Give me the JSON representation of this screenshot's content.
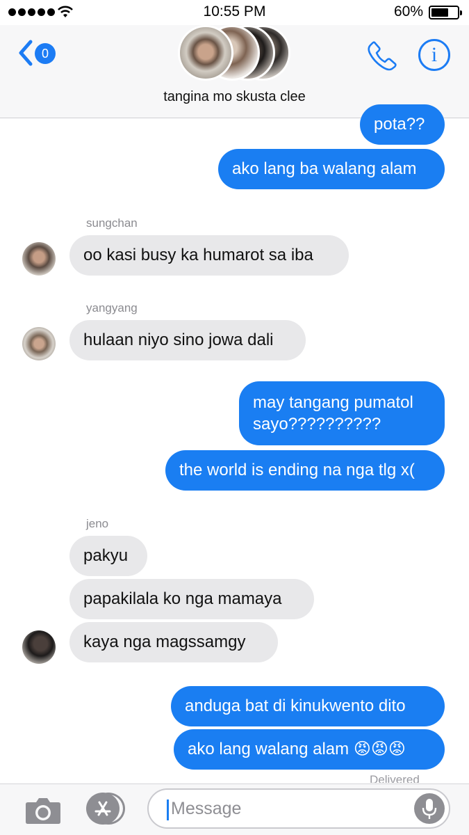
{
  "status_bar": {
    "time": "10:55 PM",
    "battery_percent": "60%",
    "battery_level": 0.6,
    "signal_dots": 5
  },
  "header": {
    "back_badge": "0",
    "group_name": "tangina mo skusta clee",
    "icons": [
      "chevron-left-icon",
      "phone-icon",
      "info-icon"
    ]
  },
  "messages": [
    {
      "direction": "out",
      "text": "pota??"
    },
    {
      "direction": "out",
      "text": "ako lang ba walang alam"
    },
    {
      "direction": "in",
      "sender": "sungchan",
      "text": "oo kasi busy ka humarot sa iba"
    },
    {
      "direction": "in",
      "sender": "yangyang",
      "text": "hulaan niyo sino jowa dali"
    },
    {
      "direction": "out",
      "text": "may tangang pumatol sayo??????????"
    },
    {
      "direction": "out",
      "text": "the world is ending na nga tlg x("
    },
    {
      "direction": "in",
      "sender": "jeno",
      "text": "pakyu"
    },
    {
      "direction": "in",
      "sender": "jeno",
      "text": "papakilala ko nga mamaya"
    },
    {
      "direction": "in",
      "sender": "jeno",
      "text": "kaya nga magssamgy"
    },
    {
      "direction": "out",
      "text": "anduga bat di kinukwento dito"
    },
    {
      "direction": "out",
      "text": "ako lang walang alam 😡😡😡"
    }
  ],
  "status_text": "Delivered",
  "composer": {
    "placeholder": "Message",
    "icons": [
      "camera-icon",
      "app-store-icon",
      "microphone-icon"
    ]
  },
  "colors": {
    "accent": "#1c7cf4",
    "outgoing_bubble": "#1a7ef2",
    "incoming_bubble": "#e8e8ea"
  }
}
